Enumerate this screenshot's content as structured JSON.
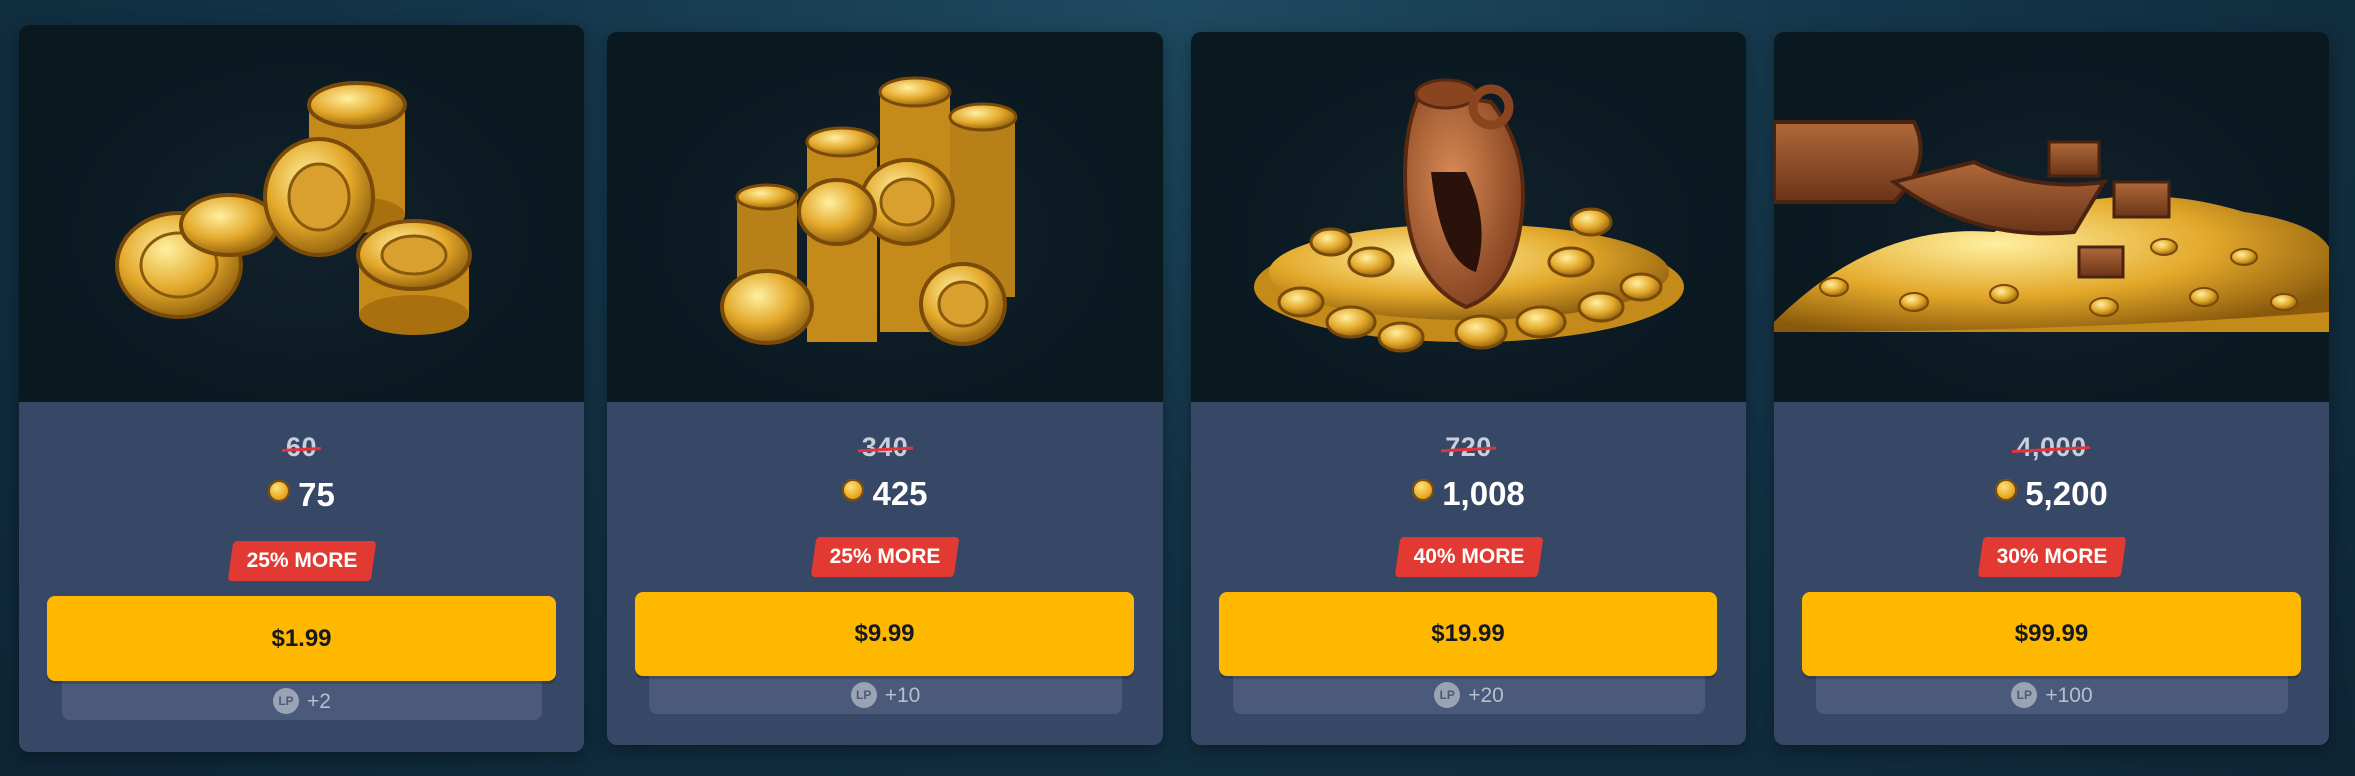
{
  "colors": {
    "card_bg": "#374766",
    "art_bg": "#0a1820",
    "badge_red": "#e23a33",
    "button_yellow": "#ffb800",
    "lp_strip": "#4b5a7a"
  },
  "packs": [
    {
      "image": "small-coin-stack",
      "old_amount": "60",
      "amount": "75",
      "bonus": "25% MORE",
      "price": "$1.99",
      "lp_icon": "LP",
      "lp_bonus": "+2"
    },
    {
      "image": "coin-tower",
      "old_amount": "340",
      "amount": "425",
      "bonus": "25% MORE",
      "price": "$9.99",
      "lp_icon": "LP",
      "lp_bonus": "+10"
    },
    {
      "image": "amphora-of-coins",
      "old_amount": "720",
      "amount": "1,008",
      "bonus": "40% MORE",
      "price": "$19.99",
      "lp_icon": "LP",
      "lp_bonus": "+20"
    },
    {
      "image": "treasure-boat-hoard",
      "old_amount": "4,000",
      "amount": "5,200",
      "bonus": "30% MORE",
      "price": "$99.99",
      "lp_icon": "LP",
      "lp_bonus": "+100"
    }
  ]
}
